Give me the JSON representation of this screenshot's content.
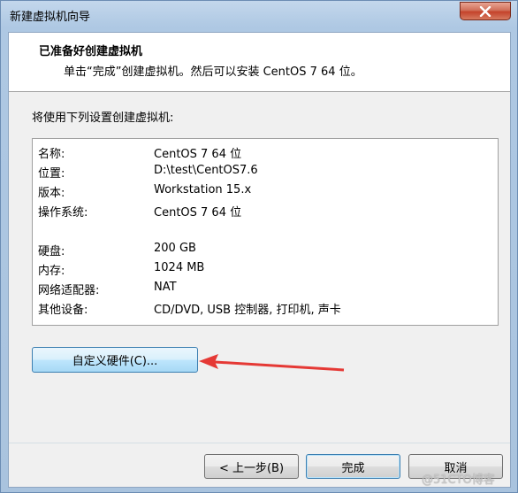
{
  "window": {
    "title": "新建虚拟机向导"
  },
  "header": {
    "title": "已准备好创建虚拟机",
    "subtitle": "单击“完成”创建虚拟机。然后可以安装 CentOS 7 64 位。"
  },
  "intro": "将使用下列设置创建虚拟机:",
  "summary": {
    "rows": [
      {
        "key": "名称:",
        "value": "CentOS 7 64 位"
      },
      {
        "key": "位置:",
        "value": "D:\\test\\CentOS7.6"
      },
      {
        "key": "版本:",
        "value": "Workstation 15.x"
      },
      {
        "key": "操作系统:",
        "value": "CentOS 7 64 位"
      },
      {
        "key": "硬盘:",
        "value": "200 GB"
      },
      {
        "key": "内存:",
        "value": "1024 MB"
      },
      {
        "key": "网络适配器:",
        "value": "NAT"
      },
      {
        "key": "其他设备:",
        "value": "CD/DVD, USB 控制器, 打印机, 声卡"
      }
    ]
  },
  "buttons": {
    "customize": "自定义硬件(C)...",
    "back": "< 上一步(B)",
    "finish": "完成",
    "cancel": "取消"
  },
  "colors": {
    "arrow": "#e53935",
    "accent_border": "#3c7fb1"
  },
  "watermark": "@51CTO博客"
}
